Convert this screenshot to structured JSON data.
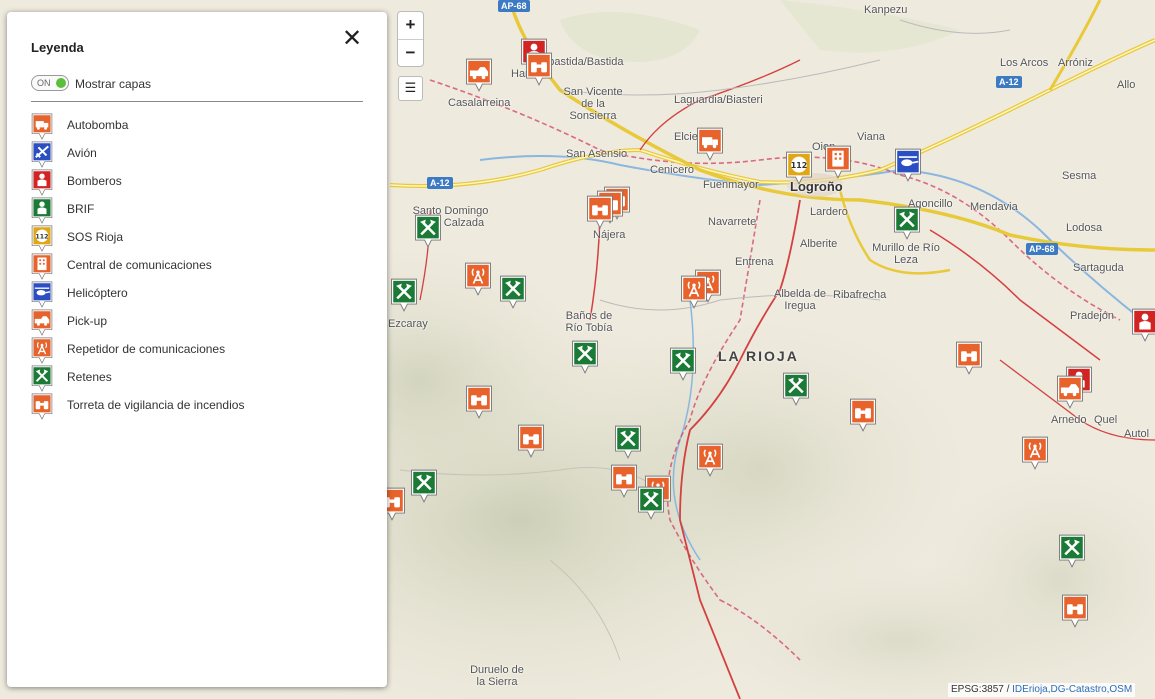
{
  "colors": {
    "orange": "#e8632c",
    "green": "#1b7a36",
    "blue": "#2b4fc2",
    "yellow": "#e0a616",
    "red": "#d32424",
    "road_yellow": "#e8c93a",
    "road_red": "#d44040",
    "river": "#8ab6e0"
  },
  "legend": {
    "title": "Leyenda",
    "toggle_state": "ON",
    "toggle_label": "Mostrar capas",
    "close_symbol": "✕",
    "items": [
      {
        "label": "Autobomba",
        "icon": "fire-truck-icon",
        "color": "orange",
        "glyph": "truck"
      },
      {
        "label": "Avión",
        "icon": "airplane-icon",
        "color": "blue",
        "glyph": "plane"
      },
      {
        "label": "Bomberos",
        "icon": "firefighter-icon",
        "color": "red",
        "glyph": "person"
      },
      {
        "label": "BRIF",
        "icon": "brif-icon",
        "color": "green",
        "glyph": "person"
      },
      {
        "label": "SOS Rioja",
        "icon": "sos-rioja-icon",
        "color": "yellow",
        "glyph": "sos"
      },
      {
        "label": "Central de comunicaciones",
        "icon": "comms-center-icon",
        "color": "orange",
        "glyph": "building"
      },
      {
        "label": "Helicóptero",
        "icon": "helicopter-icon",
        "color": "blue",
        "glyph": "heli"
      },
      {
        "label": "Pick-up",
        "icon": "pickup-icon",
        "color": "orange",
        "glyph": "pickup"
      },
      {
        "label": "Repetidor de comunicaciones",
        "icon": "repeater-icon",
        "color": "orange",
        "glyph": "antenna"
      },
      {
        "label": "Retenes",
        "icon": "retenes-icon",
        "color": "green",
        "glyph": "tools"
      },
      {
        "label": "Torreta de vigilancia de incendios",
        "icon": "watchtower-icon",
        "color": "orange",
        "glyph": "binoculars"
      }
    ]
  },
  "controls": {
    "zoom_in": "+",
    "zoom_out": "−",
    "layers": "☰"
  },
  "map": {
    "region_label": "LA RIOJA",
    "road_badges": [
      "AP-68",
      "A-12",
      "A-12",
      "AP-68"
    ],
    "places": [
      "Kanpezu",
      "Haro",
      "Labastida/Bastida",
      "Los Arcos",
      "Arróniz",
      "Allo",
      "San Vicente de la Sonsierra",
      "Casalarreina",
      "Laguardia/Biasteri",
      "Viana",
      "Elciego",
      "San Asensio",
      "Cenicero",
      "Oion",
      "Fuenmayor",
      "Logroño",
      "Sesma",
      "Santo Domingo de la Calzada",
      "Nájera",
      "Navarrete",
      "Lardero",
      "Agoncillo",
      "Mendavia",
      "Alberite",
      "Murillo de Río Leza",
      "Lodosa",
      "Entrena",
      "Sartaguda",
      "Ezcaray",
      "Albelda de Iregua",
      "Ribafrecha",
      "Baños de Río Tobía",
      "Pradejón",
      "Arnedo",
      "Quel",
      "Autol",
      "Duruelo de la Sierra"
    ],
    "markers": [
      {
        "type": "firefighter",
        "color": "red",
        "glyph": "person"
      },
      {
        "type": "pickup",
        "color": "orange",
        "glyph": "pickup"
      },
      {
        "type": "watchtower",
        "color": "orange",
        "glyph": "binoculars"
      },
      {
        "type": "fire-truck",
        "color": "orange",
        "glyph": "truck"
      },
      {
        "type": "sos-rioja",
        "color": "yellow",
        "glyph": "sos"
      },
      {
        "type": "comms-center",
        "color": "orange",
        "glyph": "building"
      },
      {
        "type": "helicopter",
        "color": "blue",
        "glyph": "heli"
      },
      {
        "type": "watchtower",
        "color": "orange",
        "glyph": "binoculars"
      },
      {
        "type": "watchtower",
        "color": "orange",
        "glyph": "binoculars"
      },
      {
        "type": "watchtower",
        "color": "orange",
        "glyph": "binoculars"
      },
      {
        "type": "retenes",
        "color": "green",
        "glyph": "tools"
      },
      {
        "type": "retenes",
        "color": "green",
        "glyph": "tools"
      },
      {
        "type": "repeater",
        "color": "orange",
        "glyph": "antenna"
      },
      {
        "type": "retenes",
        "color": "green",
        "glyph": "tools"
      },
      {
        "type": "retenes",
        "color": "green",
        "glyph": "tools"
      },
      {
        "type": "repeater",
        "color": "orange",
        "glyph": "antenna"
      },
      {
        "type": "repeater",
        "color": "orange",
        "glyph": "antenna"
      },
      {
        "type": "retenes",
        "color": "green",
        "glyph": "tools"
      },
      {
        "type": "retenes",
        "color": "green",
        "glyph": "tools"
      },
      {
        "type": "retenes",
        "color": "green",
        "glyph": "tools"
      },
      {
        "type": "watchtower",
        "color": "orange",
        "glyph": "binoculars"
      },
      {
        "type": "watchtower",
        "color": "orange",
        "glyph": "binoculars"
      },
      {
        "type": "watchtower",
        "color": "orange",
        "glyph": "binoculars"
      },
      {
        "type": "retenes",
        "color": "green",
        "glyph": "tools"
      },
      {
        "type": "watchtower",
        "color": "orange",
        "glyph": "binoculars"
      },
      {
        "type": "repeater",
        "color": "orange",
        "glyph": "antenna"
      },
      {
        "type": "watchtower",
        "color": "orange",
        "glyph": "binoculars"
      },
      {
        "type": "repeater",
        "color": "orange",
        "glyph": "antenna"
      },
      {
        "type": "retenes",
        "color": "green",
        "glyph": "tools"
      },
      {
        "type": "retenes",
        "color": "green",
        "glyph": "tools"
      },
      {
        "type": "firefighter",
        "color": "red",
        "glyph": "person"
      },
      {
        "type": "pickup",
        "color": "orange",
        "glyph": "pickup"
      },
      {
        "type": "watchtower",
        "color": "orange",
        "glyph": "binoculars"
      },
      {
        "type": "repeater",
        "color": "orange",
        "glyph": "antenna"
      },
      {
        "type": "retenes",
        "color": "green",
        "glyph": "tools"
      },
      {
        "type": "watchtower",
        "color": "orange",
        "glyph": "binoculars"
      },
      {
        "type": "firefighter",
        "color": "red",
        "glyph": "person"
      }
    ]
  },
  "attribution": {
    "prefix": "EPSG:3857 / ",
    "sources": "IDErioja,DG-Catastro,OSM"
  }
}
